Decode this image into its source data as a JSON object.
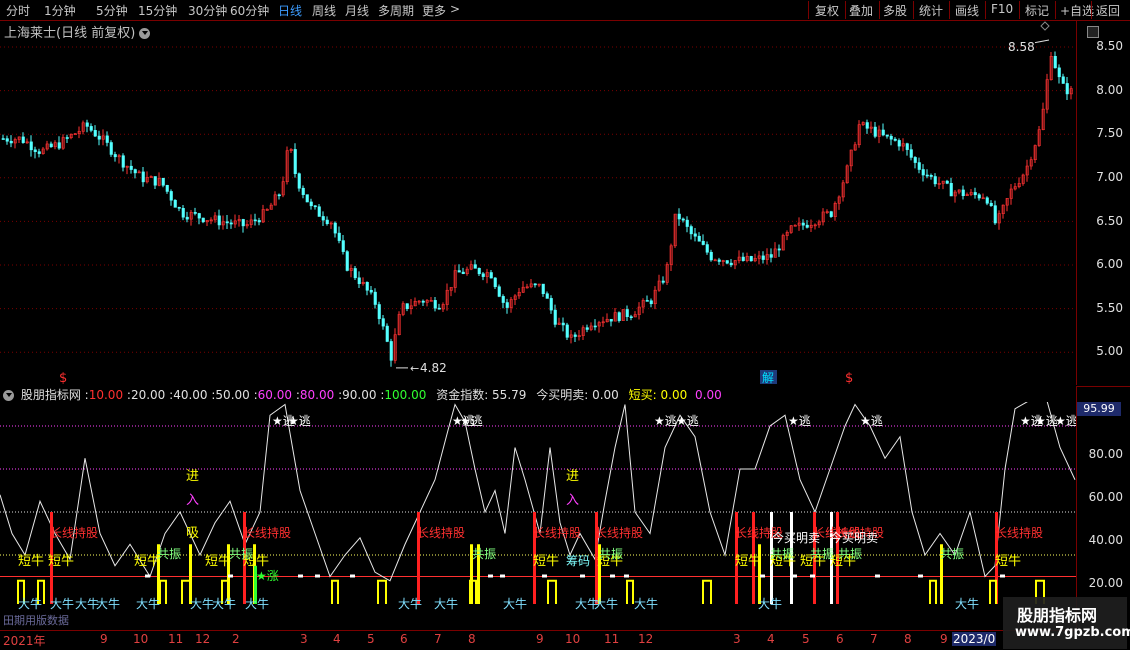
{
  "toolbar": {
    "left_items": [
      "分时",
      "1分钟",
      "5分钟",
      "15分钟",
      "30分钟",
      "60分钟",
      "日线",
      "周线",
      "月线",
      "多周期",
      "更多"
    ],
    "more_arrow": ">",
    "right_items": [
      "复权",
      "叠加",
      "多股",
      "统计",
      "画线",
      "F10",
      "标记",
      "+自选",
      "返回"
    ]
  },
  "main_chart": {
    "title": "上海莱士(日线 前复权)",
    "high_label": "8.58",
    "low_label": "4.82",
    "y_ticks": [
      "8.50",
      "8.00",
      "7.50",
      "7.00",
      "6.50",
      "6.00",
      "5.50",
      "5.00"
    ],
    "markers": [
      "$",
      "解",
      "$"
    ]
  },
  "indicator": {
    "name": "股朋指标网",
    "levels": [
      {
        "text": "10.00",
        "color": "#ff3030"
      },
      {
        "text": "20.00",
        "color": "#e0e0e0"
      },
      {
        "text": "40.00",
        "color": "#e0e0e0"
      },
      {
        "text": "50.00",
        "color": "#e0e0e0"
      },
      {
        "text": "60.00",
        "color": "#ff40ff"
      },
      {
        "text": "80.00",
        "color": "#ff40ff"
      },
      {
        "text": "90.00",
        "color": "#e0e0e0"
      },
      {
        "text": "100.00",
        "color": "#30ff30"
      }
    ],
    "fund_index": "资金指数: 55.79",
    "buy_sell": "今买明卖: 0.00",
    "short_buy": "短买: 0.00",
    "short_buy_tail": "0.00",
    "current_value": "95.99",
    "y_ticks": [
      "80.00",
      "60.00",
      "40.00",
      "20.00"
    ],
    "labels": {
      "escape": "★逃",
      "enter": "进",
      "enter2": "入",
      "absorb": "吸",
      "absorb2": "筹",
      "long_hold": "长线持股",
      "short_bull": "短牛",
      "resonance": "共振",
      "big_bull": "大牛",
      "rise": "★涨",
      "buy_today_sell_tomorrow": "今买明卖",
      "chip": "筹码"
    }
  },
  "date_axis": {
    "labels": [
      "2021年",
      "9",
      "10",
      "11",
      "12",
      "2",
      "3",
      "4",
      "5",
      "6",
      "7",
      "8",
      "9",
      "10",
      "11",
      "12",
      "3",
      "4",
      "5",
      "6",
      "7",
      "8",
      "9",
      "2023/0"
    ],
    "bottom_left": "田期用版数据"
  },
  "watermark": {
    "title": "股朋指标网",
    "url": "www.7gpzb.com"
  }
}
